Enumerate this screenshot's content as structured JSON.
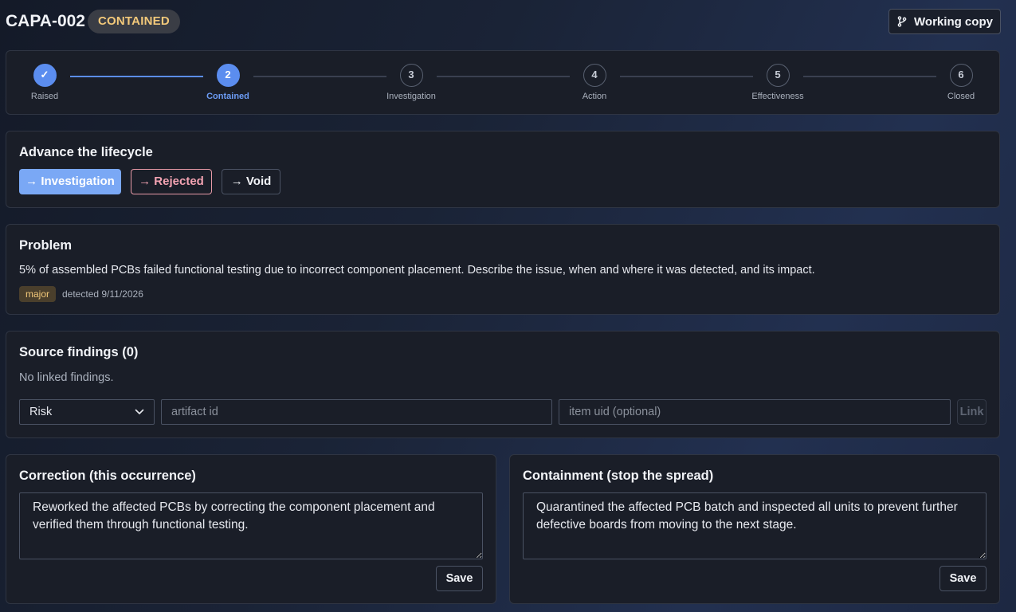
{
  "header": {
    "title": "CAPA-002",
    "status": "CONTAINED",
    "working_copy_label": "Working copy",
    "working_copy_icon": "git-branch-icon"
  },
  "stepper": {
    "steps": [
      {
        "number": "✓",
        "label": "Raised",
        "state": "done"
      },
      {
        "number": "2",
        "label": "Contained",
        "state": "current"
      },
      {
        "number": "3",
        "label": "Investigation",
        "state": "pending"
      },
      {
        "number": "4",
        "label": "Action",
        "state": "pending"
      },
      {
        "number": "5",
        "label": "Effectiveness",
        "state": "pending"
      },
      {
        "number": "6",
        "label": "Closed",
        "state": "pending"
      }
    ]
  },
  "lifecycle": {
    "title": "Advance the lifecycle",
    "actions": [
      {
        "label": "→ Investigation"
      },
      {
        "label": "→ Rejected"
      },
      {
        "label": "→ Void"
      }
    ]
  },
  "problem": {
    "title": "Problem",
    "description": "5% of assembled PCBs failed functional testing due to incorrect component placement. Describe the issue, when and where it was detected, and its impact.",
    "severity": "major",
    "detected": "detected 9/11/2026"
  },
  "findings": {
    "title": "Source findings (0)",
    "empty": "No linked findings.",
    "type_selected": "Risk",
    "artifact_placeholder": "artifact id",
    "item_placeholder": "item uid (optional)",
    "link_label": "Link"
  },
  "correction": {
    "title": "Correction (this occurrence)",
    "text": "Reworked the affected PCBs by correcting the component placement and verified them through functional testing.",
    "save_label": "Save"
  },
  "containment": {
    "title": "Containment (stop the spread)",
    "text": "Quarantined the affected PCB batch and inspected all units to prevent further defective boards from moving to the next stage.",
    "save_label": "Save"
  },
  "colors": {
    "accent": "#5b8def",
    "warning": "#f3c97a",
    "danger": "#f3a3b2"
  }
}
